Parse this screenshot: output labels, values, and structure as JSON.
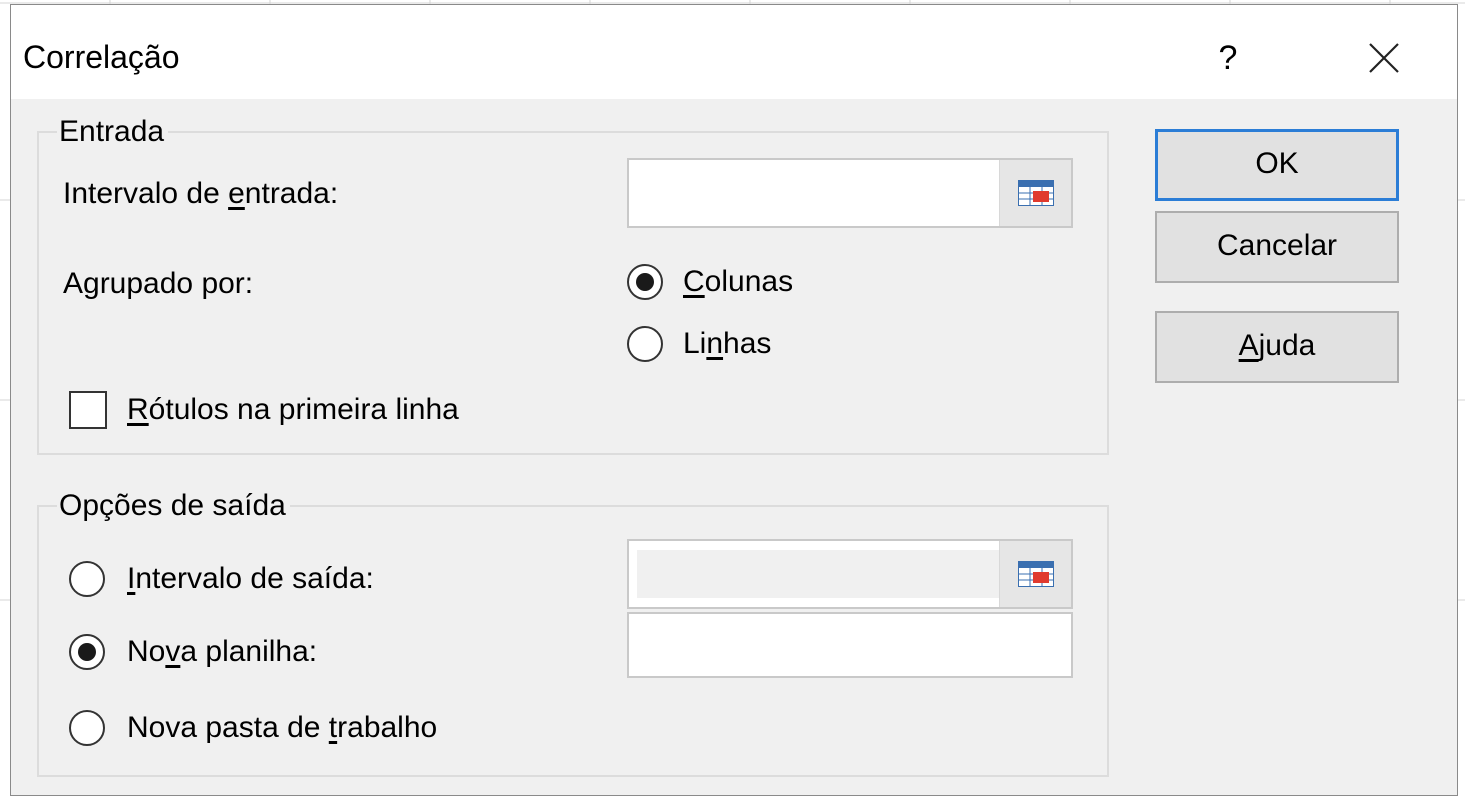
{
  "dialog": {
    "title": "Correlação",
    "help_label": "?"
  },
  "input_group": {
    "legend": "Entrada",
    "range_label_pre": "Intervalo de ",
    "range_label_u": "e",
    "range_label_post": "ntrada:",
    "range_value": "",
    "grouped_label": "Agrupado por:",
    "columns_u": "C",
    "columns_rest": "olunas",
    "columns_checked": true,
    "rows_pre": "Li",
    "rows_u": "n",
    "rows_post": "has",
    "rows_checked": false,
    "labels_u": "R",
    "labels_rest": "ótulos na primeira linha",
    "labels_checked": false
  },
  "output_group": {
    "legend": "Opções de saída",
    "range_u": "I",
    "range_rest": "ntervalo de saída:",
    "range_checked": false,
    "range_value": "",
    "new_sheet_pre": "No",
    "new_sheet_u": "v",
    "new_sheet_post": "a planilha:",
    "new_sheet_checked": true,
    "new_sheet_value": "",
    "new_workbook_pre": "Nova pasta de ",
    "new_workbook_u": "t",
    "new_workbook_post": "rabalho",
    "new_workbook_checked": false
  },
  "buttons": {
    "ok": "OK",
    "cancel": "Cancelar",
    "help_u": "A",
    "help_rest": "juda"
  },
  "colors": {
    "dialog_bg": "#f0f0f0",
    "default_button_border": "#2b7dd6"
  },
  "icons": {
    "close": "close-icon",
    "range_selector": "range-selector-icon"
  }
}
